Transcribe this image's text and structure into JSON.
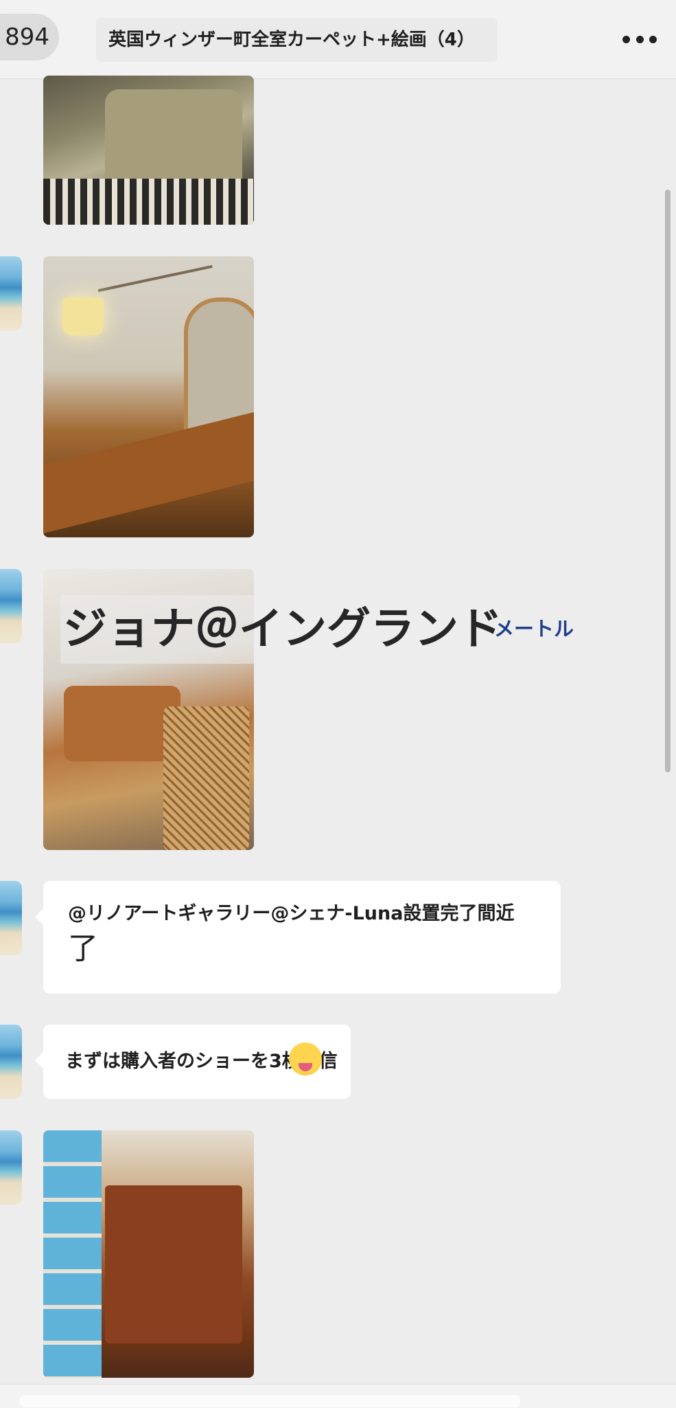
{
  "header": {
    "back_count": "894",
    "title": "英国ウィンザー町全室カーペット+絵画（4）",
    "more_icon": "more-dots-icon"
  },
  "overlay": {
    "name": "ジョナ＠イングランド",
    "meta": "メートル"
  },
  "messages": [
    {
      "type": "image",
      "alt": "living-room-armchair-photo"
    },
    {
      "type": "image",
      "alt": "lamp-mirror-desk-photo"
    },
    {
      "type": "image",
      "alt": "cane-chair-sofa-photo"
    },
    {
      "type": "text",
      "line1": "@リノアートギャラリー@シェナ-Luna設置完了間近",
      "line2": "了"
    },
    {
      "type": "text",
      "line1": "まずは購入者のショーを3枚送信",
      "emoji": "tongue-out-face-emoji"
    },
    {
      "type": "image",
      "alt": "wooden-cabinet-photo"
    }
  ],
  "colors": {
    "background": "#ededed",
    "bubble": "#ffffff",
    "overlay_meta": "#1f3f8c"
  }
}
